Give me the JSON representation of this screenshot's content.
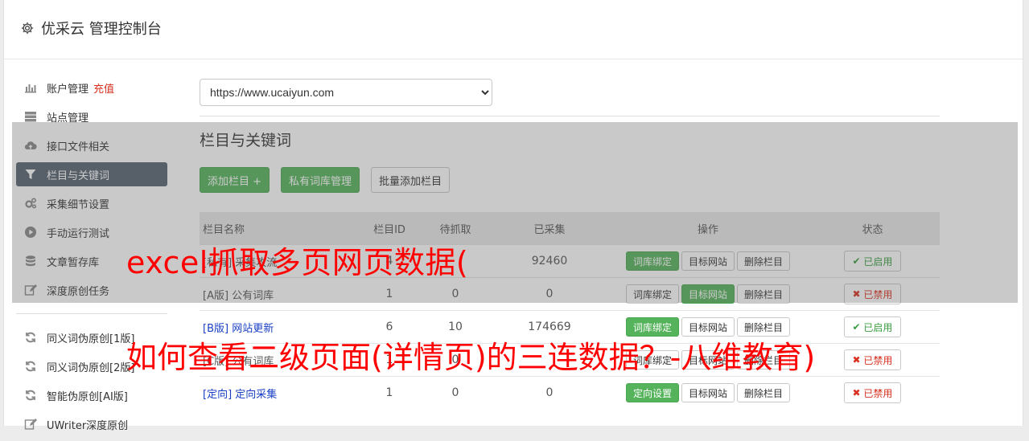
{
  "app": {
    "title": "优采云 管理控制台"
  },
  "sidebar": {
    "recharge": "充值",
    "items": [
      {
        "label": "账户管理",
        "icon": "bar-chart-icon"
      },
      {
        "label": "站点管理",
        "icon": "server-icon"
      },
      {
        "label": "接口文件相关",
        "icon": "cloud-upload-icon"
      },
      {
        "label": "栏目与关键词",
        "icon": "filter-icon"
      },
      {
        "label": "采集细节设置",
        "icon": "gears-icon"
      },
      {
        "label": "手动运行测试",
        "icon": "play-circle-icon"
      },
      {
        "label": "文章暂存库",
        "icon": "database-icon"
      },
      {
        "label": "深度原创任务",
        "icon": "edit-icon"
      }
    ],
    "items2": [
      {
        "label": "同义词伪原创[1版]",
        "icon": "refresh-icon"
      },
      {
        "label": "同义词伪原创[2版]",
        "icon": "refresh-icon"
      },
      {
        "label": "智能伪原创[AI版]",
        "icon": "refresh-icon"
      },
      {
        "label": "UWriter深度原创",
        "icon": "edit-icon"
      }
    ]
  },
  "site_select": {
    "value": "https://www.ucaiyun.com"
  },
  "section": {
    "title": "栏目与关键词"
  },
  "buttons": {
    "add_column": "添加栏目 +",
    "private_lib": "私有词库管理",
    "batch_add": "批量添加栏目"
  },
  "table": {
    "headers": {
      "name": "栏目名称",
      "id": "栏目ID",
      "pending": "待抓取",
      "collected": "已采集",
      "ops": "操作",
      "status": "状态"
    },
    "rows": [
      {
        "name": "[私有] 采集攻流",
        "id": "4",
        "pending": "",
        "collected": "92460",
        "op1": "词库绑定",
        "op2": "目标网站",
        "op3": "删除栏目",
        "status": "已启用"
      },
      {
        "name": "[A版] 公有词库",
        "id": "1",
        "pending": "0",
        "collected": "0",
        "op1": "词库绑定",
        "op2": "目标网站",
        "op3": "删除栏目",
        "status": "已禁用"
      },
      {
        "name": "[B版] 网站更新",
        "id": "6",
        "pending": "10",
        "collected": "174669",
        "op1": "词库绑定",
        "op2": "目标网站",
        "op3": "删除栏目",
        "status": "已启用"
      },
      {
        "name": "[C版] 公有词库",
        "id": "1",
        "pending": "0",
        "collected": "",
        "op1": "词库绑定",
        "op2": "目标网站",
        "op3": "删除栏目",
        "status": "已禁用"
      },
      {
        "name": "[定向] 定向采集",
        "id": "1",
        "pending": "0",
        "collected": "0",
        "op1": "定向设置",
        "op2": "目标网站",
        "op3": "删除栏目",
        "status": "已禁用"
      }
    ]
  },
  "overlay_text": {
    "line1": "excel抓取多页网页数据(",
    "line2": "如何查看二级页面(详情页)的三连数据？-八维教育)"
  },
  "colors": {
    "accent_green": "#55b35b",
    "active_nav": "#556271",
    "danger": "#d9301f",
    "overlay_text": "#ff0000"
  }
}
